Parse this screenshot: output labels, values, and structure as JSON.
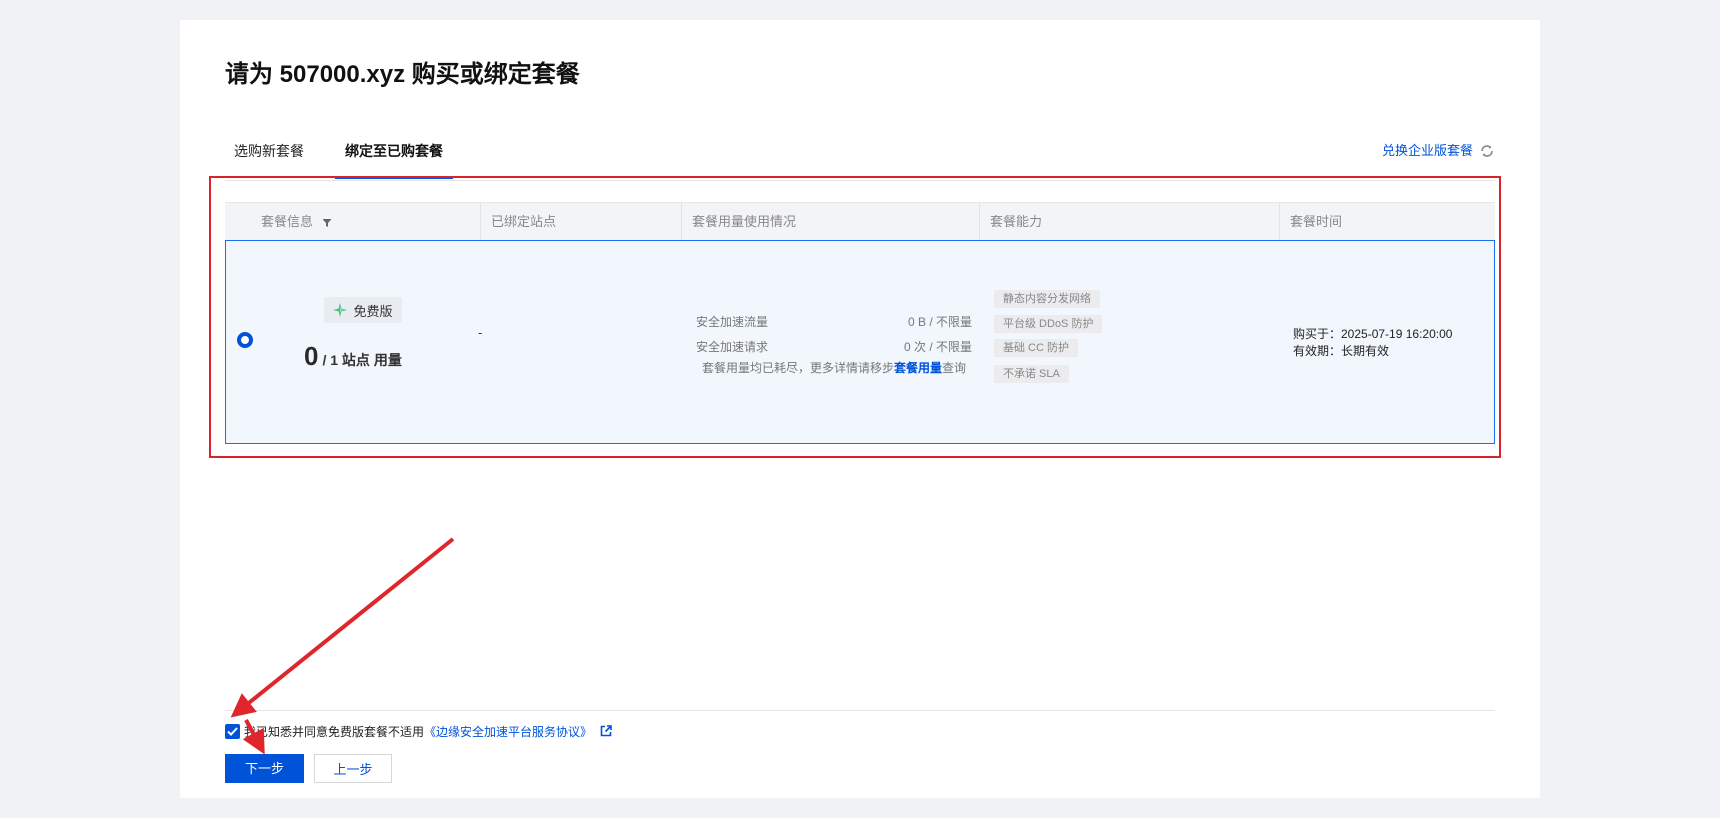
{
  "page": {
    "title": "请为 507000.xyz 购买或绑定套餐"
  },
  "tabs": [
    {
      "label": "选购新套餐",
      "active": false
    },
    {
      "label": "绑定至已购套餐",
      "active": true
    }
  ],
  "enterprise_link": "兑换企业版套餐",
  "table": {
    "headers": [
      "套餐信息",
      "已绑定站点",
      "套餐用量使用情况",
      "套餐能力",
      "套餐时间"
    ],
    "row": {
      "selected": true,
      "plan_name": "免费版",
      "usage_count": "0",
      "usage_rest": "/ 1 站点 用量",
      "bound_sites": "-",
      "usage_items": [
        {
          "label": "安全加速流量",
          "value": "0 B / 不限量"
        },
        {
          "label": "安全加速请求",
          "value": "0 次 / 不限量"
        }
      ],
      "usage_note_prefix": "套餐用量均已耗尽，更多详情请移步",
      "usage_note_link": "套餐用量",
      "usage_note_suffix": "查询",
      "capabilities": [
        "静态内容分发网络",
        "平台级 DDoS 防护",
        "基础 CC 防护",
        "不承诺 SLA"
      ],
      "purchased": "购买于：2025-07-19 16:20:00",
      "validity": "有效期：长期有效"
    }
  },
  "agreement": {
    "checked": true,
    "text": "我已知悉并同意免费版套餐不适用",
    "link": "《边缘安全加速平台服务协议》"
  },
  "buttons": {
    "next": "下一步",
    "prev": "上一步"
  },
  "colors": {
    "primary": "#0052d9",
    "highlight": "#d9232b",
    "selected_row_bg": "#f2f6fd"
  }
}
